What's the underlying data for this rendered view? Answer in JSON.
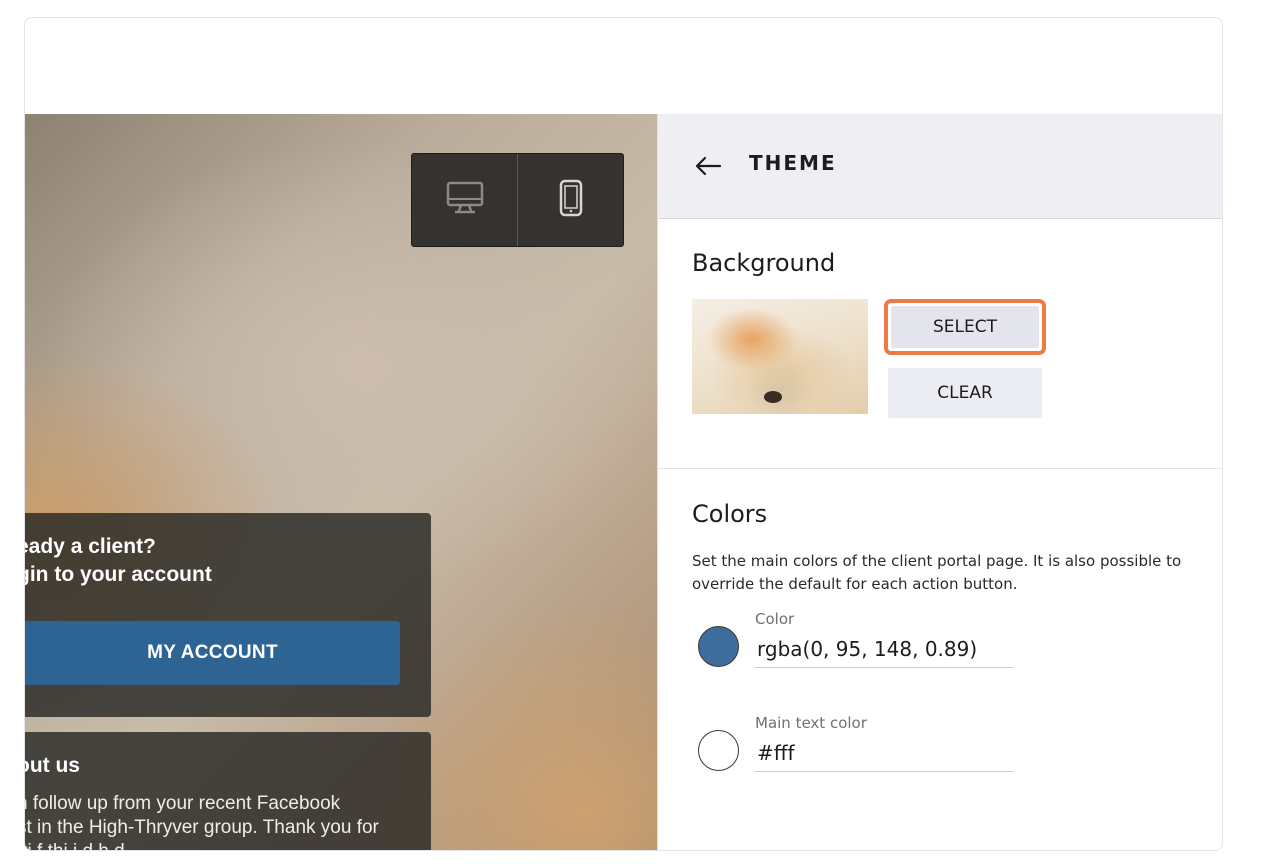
{
  "preview": {
    "device_switch": {
      "desktop_icon": "desktop-icon",
      "mobile_icon": "mobile-icon"
    },
    "login_card": {
      "title_line1": "eady a client?",
      "title_line2": "gin to your account",
      "button_label": "MY ACCOUNT"
    },
    "about_card": {
      "title": "out us",
      "body_line1": "n follow up from your recent Facebook",
      "body_line2": "st in the High-Thryver group. Thank you for",
      "body_line3": "tti       f thi i      d h          d"
    }
  },
  "panel": {
    "header": {
      "back_icon": "arrow-left-icon",
      "title": "THEME"
    },
    "background": {
      "title": "Background",
      "select_label": "SELECT",
      "clear_label": "CLEAR",
      "highlight_color": "#ee7a45"
    },
    "colors": {
      "title": "Colors",
      "description": "Set the main colors of the client portal page. It is also possible to override the default for each action button.",
      "fields": [
        {
          "label": "Color",
          "value": "rgba(0, 95, 148, 0.89)",
          "swatch": "#3d6d9c"
        },
        {
          "label": "Main text color",
          "value": "#fff",
          "swatch": "#ffffff"
        }
      ]
    }
  }
}
